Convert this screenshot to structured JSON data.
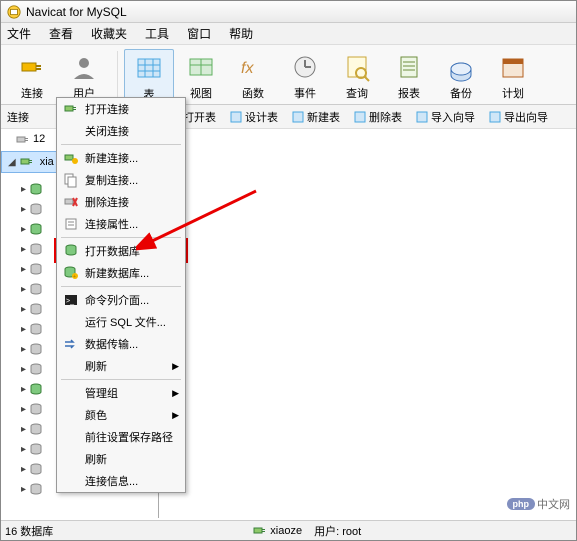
{
  "title": "Navicat for MySQL",
  "menubar": [
    "文件",
    "查看",
    "收藏夹",
    "工具",
    "窗口",
    "帮助"
  ],
  "toolbar": [
    {
      "label": "连接",
      "icon": "plug-icon",
      "color": "#f5b800"
    },
    {
      "label": "用户",
      "icon": "user-icon",
      "color": "#555"
    },
    {
      "label": "表",
      "icon": "table-icon",
      "color": "#4aa7e0"
    },
    {
      "label": "视图",
      "icon": "view-icon",
      "color": "#5fb05f"
    },
    {
      "label": "函数",
      "icon": "fx-icon",
      "color": "#c78b3c"
    },
    {
      "label": "事件",
      "icon": "clock-icon",
      "color": "#777"
    },
    {
      "label": "查询",
      "icon": "query-icon",
      "color": "#caa638"
    },
    {
      "label": "报表",
      "icon": "report-icon",
      "color": "#6e8e3e"
    },
    {
      "label": "备份",
      "icon": "backup-icon",
      "color": "#3a6fb5"
    },
    {
      "label": "计划",
      "icon": "schedule-icon",
      "color": "#b35f1e"
    }
  ],
  "left_panel_label": "连接",
  "tree": {
    "item1": "12",
    "item2": "xia"
  },
  "sub_toolbar": [
    "打开表",
    "设计表",
    "新建表",
    "删除表",
    "导入向导",
    "导出向导"
  ],
  "context_menu": [
    {
      "label": "打开连接",
      "icon": "plug-icon"
    },
    {
      "label": "关闭连接",
      "icon": ""
    },
    {
      "sep": true
    },
    {
      "label": "新建连接...",
      "icon": "plug-new-icon"
    },
    {
      "label": "复制连接...",
      "icon": "copy-icon"
    },
    {
      "label": "删除连接",
      "icon": "delete-icon"
    },
    {
      "label": "连接属性...",
      "icon": "props-icon"
    },
    {
      "sep": true
    },
    {
      "label": "打开数据库",
      "icon": "db-open-icon"
    },
    {
      "label": "新建数据库...",
      "icon": "db-new-icon",
      "highlight": true
    },
    {
      "sep": true
    },
    {
      "label": "命令列介面...",
      "icon": "cmd-icon"
    },
    {
      "label": "运行 SQL 文件...",
      "icon": ""
    },
    {
      "label": "数据传输...",
      "icon": "transfer-icon"
    },
    {
      "label": "刷新",
      "icon": "",
      "arrow": true
    },
    {
      "sep": true
    },
    {
      "label": "管理组",
      "icon": "",
      "arrow": true
    },
    {
      "label": "颜色",
      "icon": "",
      "arrow": true
    },
    {
      "label": "前往设置保存路径",
      "icon": ""
    },
    {
      "label": "刷新",
      "icon": ""
    },
    {
      "label": "连接信息...",
      "icon": ""
    }
  ],
  "status": {
    "left": "16 数据库",
    "right_user": "xiaoze",
    "right_label": "用户: root"
  },
  "watermark": "中文网"
}
